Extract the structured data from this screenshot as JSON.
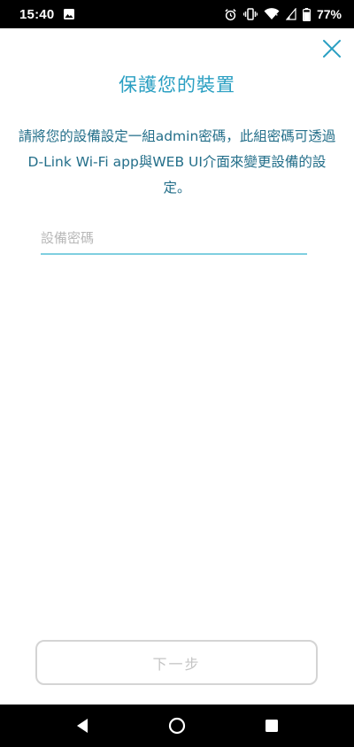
{
  "status_bar": {
    "time": "15:40",
    "battery_percent": "77%",
    "icons": [
      "image-icon",
      "alarm-icon",
      "vibrate-icon",
      "wifi-icon",
      "signal-icon",
      "battery-icon"
    ]
  },
  "colors": {
    "accent": "#2a9fc2",
    "text_secondary": "#246f8a",
    "input_underline": "#7fcfe0",
    "disabled": "#c4c4c4"
  },
  "header": {
    "title": "保護您的裝置",
    "close_icon": "close-icon"
  },
  "description": "請將您的設備設定一組admin密碼，此組密碼可透過D-Link Wi-Fi app與WEB UI介面來變更設備的設定。",
  "form": {
    "password_placeholder": "設備密碼",
    "password_value": ""
  },
  "footer": {
    "next_label": "下一步"
  },
  "nav_bar": {
    "icons": [
      "back-icon",
      "home-icon",
      "recents-icon"
    ]
  }
}
